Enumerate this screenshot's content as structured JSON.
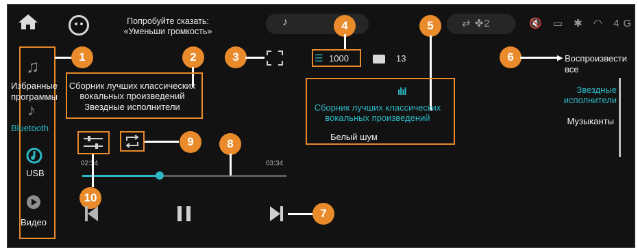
{
  "status_bar": {
    "voice_hint": "Попробуйте сказать:\n«Уменьши громкость»",
    "now_playing_icon": "music-note-icon",
    "climate_fan_label": "⇄ ✤2",
    "status_icons": "🔇 ▭ ✱ ◠ 4G"
  },
  "sidebar": {
    "items": [
      {
        "label": "Избранные\nпрограммы",
        "icon": "music-notes-icon"
      },
      {
        "label": "Bluetooth",
        "icon": "bluetooth-music-icon",
        "active": true
      },
      {
        "label": "USB",
        "icon": "usb-music-icon"
      },
      {
        "label": "Видео",
        "icon": "video-play-icon"
      }
    ]
  },
  "player": {
    "playlist_title": "Сборник лучших классических\nвокальных произведений",
    "artist": "Звездные исполнители",
    "time_current": "02:34",
    "time_total": "03:34",
    "progress_fraction": 0.38
  },
  "library": {
    "song_count": "1000",
    "folder_count": "13",
    "playlist_title_active": "Сборник лучших классических\nвокальных произведений",
    "playlist_other": "Белый шум",
    "play_all": "Воспроизвести\nвсе",
    "category_active": "Звездные\nисполнители",
    "category_other": "Музыканты"
  },
  "callouts": [
    "1",
    "2",
    "3",
    "4",
    "5",
    "6",
    "7",
    "8",
    "9",
    "10"
  ],
  "colors": {
    "accent_teal": "#2bb8c4",
    "callout_orange": "#e98a2b"
  }
}
